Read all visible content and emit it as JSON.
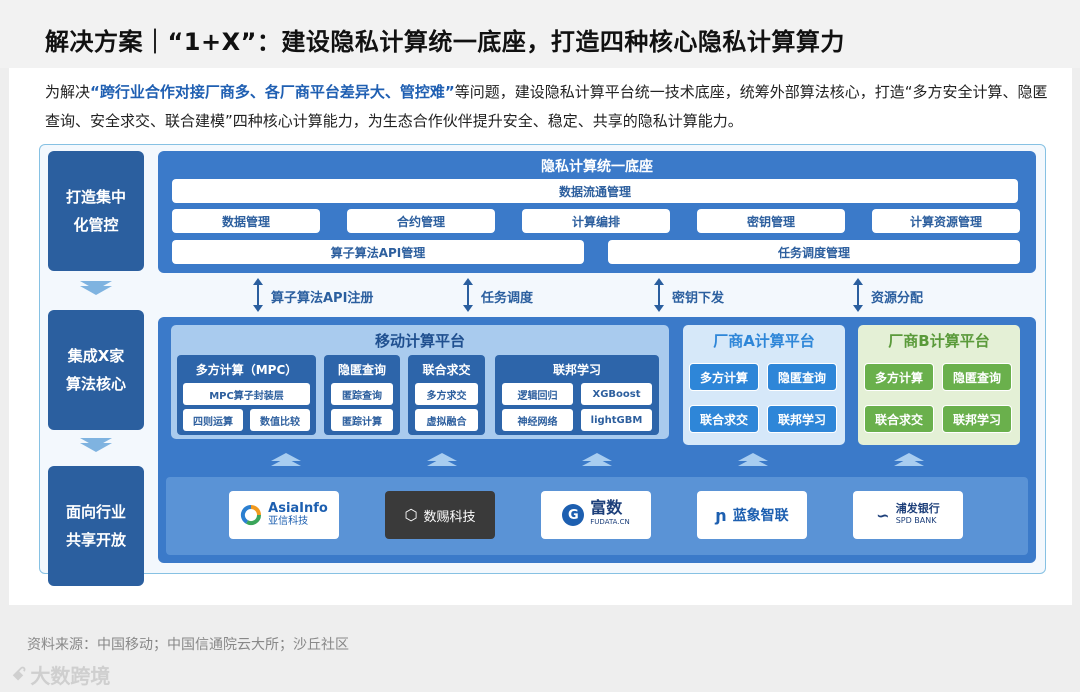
{
  "header": {
    "title": "解决方案｜“1+X”：建设隐私计算统一底座，打造四种核心隐私计算算力"
  },
  "intro": {
    "p1": "为解决",
    "highlight": "“跨行业合作对接厂商多、各厂商平台差异大、管控难”",
    "p2": "等问题，建设隐私计算平台统一技术底座，统筹外部算法核心，打造“多方安全计算、隐匿查询、安全求交、联合建模”四种核心计算能力，为生态合作伙伴提升安全、稳定、共享的隐私计算能力。"
  },
  "left_column": [
    "打造集中化管控",
    "集成X家算法核心",
    "面向行业共享开放"
  ],
  "top_panel": {
    "title": "隐私计算统一底座",
    "row1": "数据流通管理",
    "row2": [
      "数据管理",
      "合约管理",
      "计算编排",
      "密钥管理",
      "计算资源管理"
    ],
    "row3": [
      "算子算法API管理",
      "任务调度管理"
    ]
  },
  "arrows": [
    "算子算法API注册",
    "任务调度",
    "密钥下发",
    "资源分配"
  ],
  "mobile_platform": {
    "title": "移动计算平台",
    "groups": [
      {
        "title": "多方计算（MPC）",
        "items": [
          "MPC算子封装层",
          "四则运算",
          "数值比较"
        ]
      },
      {
        "title": "隐匿查询",
        "items": [
          "匿踪查询",
          "匿踪计算"
        ]
      },
      {
        "title": "联合求交",
        "items": [
          "多方求交",
          "虚拟融合"
        ]
      },
      {
        "title": "联邦学习",
        "items": [
          "逻辑回归",
          "XGBoost",
          "神经网络",
          "lightGBM"
        ]
      }
    ]
  },
  "vendor_a": {
    "title": "厂商A计算平台",
    "items": [
      "多方计算",
      "隐匿查询",
      "联合求交",
      "联邦学习"
    ]
  },
  "vendor_b": {
    "title": "厂商B计算平台",
    "items": [
      "多方计算",
      "隐匿查询",
      "联合求交",
      "联邦学习"
    ]
  },
  "logos": {
    "asiainfo": {
      "name": "AsiaInfo",
      "sub": "亚信科技"
    },
    "shuyi": "数赐科技",
    "fudata": {
      "name": "富数",
      "sub": "FUDATA.CN"
    },
    "lanxiang": "蓝象智联",
    "spdb": {
      "name": "浦发银行",
      "sub": "SPD BANK"
    }
  },
  "footer": {
    "source": "资料来源：中国移动；中国信通院云大所；沙丘社区",
    "watermark": "大数跨境"
  },
  "colors": {
    "dark_blue": "#2b5f9f",
    "panel_blue": "#3b7ac9",
    "vendor_a": "#2e86d8",
    "vendor_b": "#6ab04c",
    "highlight": "#1f5fb2"
  }
}
